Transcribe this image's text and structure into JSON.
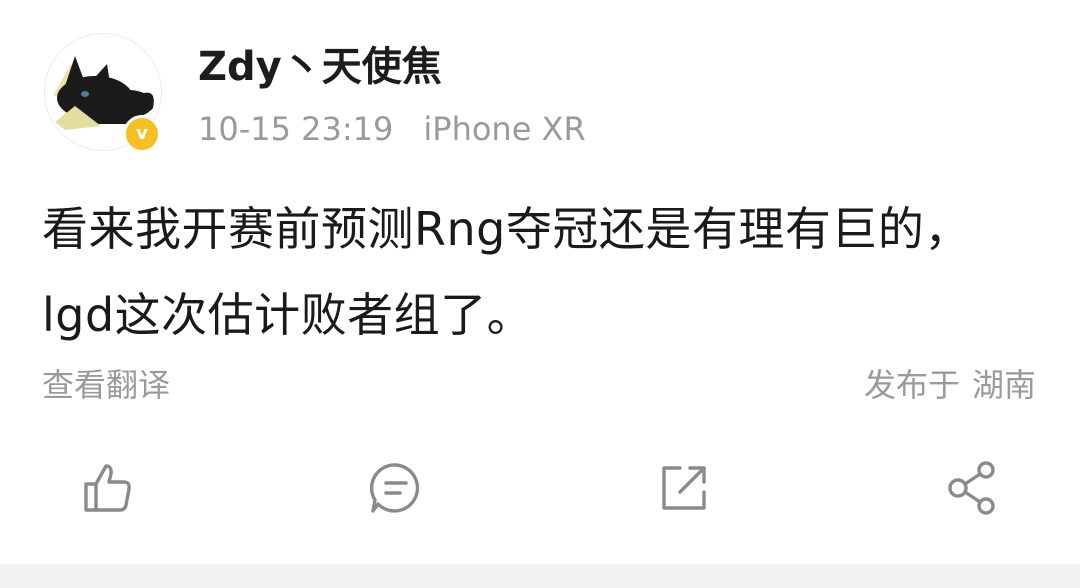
{
  "post": {
    "author": {
      "name": "Zdy丶天使焦",
      "verified_badge": "v"
    },
    "meta": {
      "time": "10-15 23:19",
      "device": "iPhone XR"
    },
    "content": "看来我开赛前预测Rng夺冠还是有理有巨的，lgd这次估计败者组了。",
    "translate_label": "查看翻译",
    "location": {
      "prefix": "发布于",
      "place": "湖南"
    },
    "actions": [
      {
        "name": "like",
        "icon": "thumbs-up-icon"
      },
      {
        "name": "comment",
        "icon": "comment-icon"
      },
      {
        "name": "repost",
        "icon": "repost-icon"
      },
      {
        "name": "share",
        "icon": "share-icon"
      }
    ]
  },
  "colors": {
    "text_primary": "#1a1a1a",
    "text_secondary": "#9a9a9a",
    "verified": "#f6bf24",
    "icon": "#8a8a8a"
  }
}
